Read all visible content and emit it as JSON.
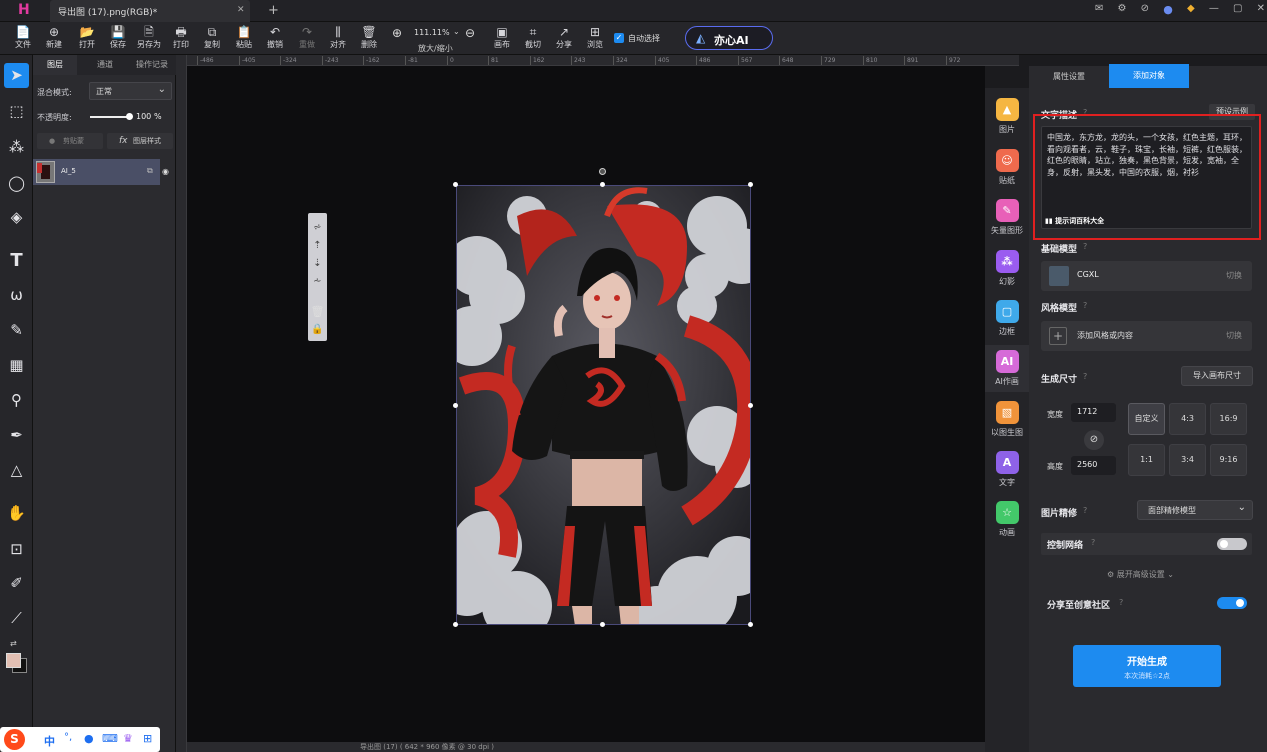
{
  "window": {
    "tab_title": "导出图 (17).png(RGB)*",
    "tab_close": "✕",
    "tab_add": "+",
    "controls": [
      "✉",
      "⚙",
      "⊘",
      "●",
      "◆",
      "—",
      "▢",
      "✕"
    ]
  },
  "toolbar": {
    "items": [
      {
        "icon": "📄",
        "label": "文件"
      },
      {
        "icon": "⊕",
        "label": "新建"
      },
      {
        "icon": "📂",
        "label": "打开"
      },
      {
        "icon": "💾",
        "label": "保存"
      },
      {
        "icon": "🗎",
        "label": "另存为"
      },
      {
        "icon": "🖶",
        "label": "打印"
      },
      {
        "icon": "⧉",
        "label": "复制"
      },
      {
        "icon": "📋",
        "label": "粘贴"
      },
      {
        "icon": "↶",
        "label": "撤销"
      },
      {
        "icon": "↷",
        "label": "重做"
      },
      {
        "icon": "⫼",
        "label": "对齐"
      },
      {
        "icon": "🗑",
        "label": "删除"
      }
    ],
    "zoom_in": "⊕",
    "zoom_value": "111.11%",
    "zoom_out": "⊖",
    "zoom_label": "放大/缩小",
    "items2": [
      {
        "icon": "▣",
        "label": "画布"
      },
      {
        "icon": "⌗",
        "label": "截切"
      },
      {
        "icon": "↗",
        "label": "分享"
      },
      {
        "icon": "⊞",
        "label": "浏览"
      }
    ],
    "auto_select_label": "自动选择",
    "ai_logo": "亦心AI"
  },
  "layers_panel": {
    "tabs": [
      "图层",
      "通道",
      "操作记录"
    ],
    "blend_mode_label": "混合模式:",
    "blend_mode_value": "正常",
    "opacity_label": "不透明度:",
    "opacity_value": "100",
    "opacity_unit": "%",
    "opacity_fraction": 1.0,
    "clip_btn": "剪贴蒙",
    "fx_btn": "图层样式",
    "layer_name": "AI_5"
  },
  "ruler": {
    "h_ticks": [
      "-486",
      "-405",
      "-324",
      "-243",
      "-162",
      "-81",
      "0",
      "81",
      "162",
      "243",
      "324",
      "405",
      "486",
      "567",
      "648",
      "729",
      "810",
      "891",
      "972"
    ]
  },
  "status": {
    "text": "导出图 (17) ( 642 * 960 像素 @ 30 dpi )"
  },
  "ai_sidebar": [
    {
      "icon": "▲",
      "label": "图片",
      "color": "#f5b642"
    },
    {
      "icon": "☺",
      "label": "贴纸",
      "color": "#ef6a4d"
    },
    {
      "icon": "✎",
      "label": "矢量图形",
      "color": "#e860b8"
    },
    {
      "icon": "⁂",
      "label": "幻影",
      "color": "#9a5cf0"
    },
    {
      "icon": "▢",
      "label": "边框",
      "color": "#3fa9ea"
    },
    {
      "icon": "AI",
      "label": "AI作画",
      "color": "#d66ad8"
    },
    {
      "icon": "▧",
      "label": "以图生图",
      "color": "#f0933a"
    },
    {
      "icon": "A",
      "label": "文字",
      "color": "#8e62e8"
    },
    {
      "icon": "☆",
      "label": "动画",
      "color": "#43c86a"
    }
  ],
  "right_panel": {
    "tabs": [
      "属性设置",
      "添加对象"
    ],
    "text_desc_label": "文字描述",
    "preset_btn": "预设示例",
    "prompt_text": "中国龙，东方龙，龙的头，一个女孩，红色主题，耳环，看向观看者，云，鞋子，珠宝，长袖，短裤，红色服装，红色的眼睛，站立，独奏，黑色背景，短发，宽袖，全身，反射，黑头发，中国的衣服，烟，衬衫",
    "hint_btn": "提示词百科大全",
    "base_model_label": "基础模型",
    "base_model_value": "CGXL",
    "switch_label": "切换",
    "style_model_label": "风格模型",
    "style_model_value": "添加风格或内容",
    "size_label": "生成尺寸",
    "import_size_btn": "导入画布尺寸",
    "width_label": "宽度",
    "width_value": "1712",
    "height_label": "高度",
    "height_value": "2560",
    "ratios": [
      "自定义",
      "4:3",
      "16:9",
      "1:1",
      "3:4",
      "9:16"
    ],
    "refine_label": "图片精修",
    "refine_value": "面部精修模型",
    "controlnet_label": "控制网络",
    "advanced_label": "展开高级设置",
    "share_label": "分享至创意社区",
    "generate_btn": "开始生成",
    "generate_cost": "本次消耗☆2点"
  },
  "taskbar": {
    "ime_text": "中"
  },
  "colors": {
    "accent": "#1d8bf0",
    "highlight_box": "#e02020",
    "fg_color": "#e2bfb3"
  }
}
